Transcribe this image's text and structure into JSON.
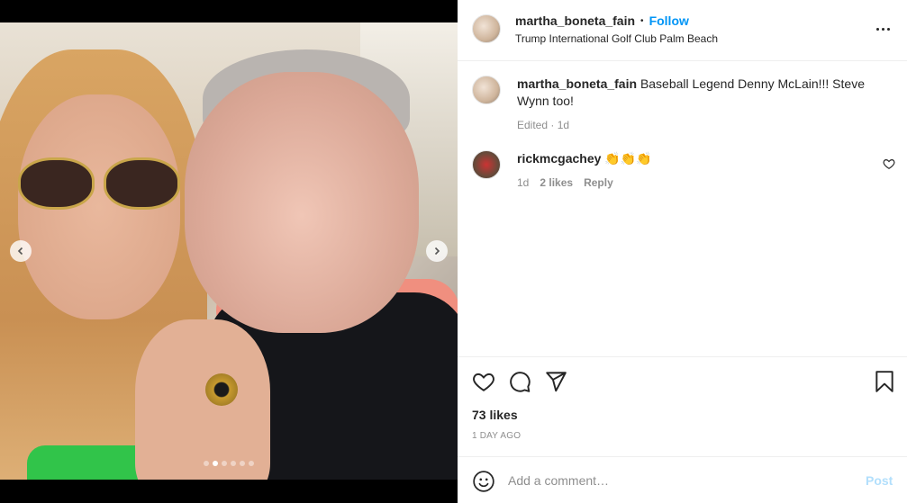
{
  "header": {
    "username": "martha_boneta_fain",
    "separator": "•",
    "follow_label": "Follow",
    "location": "Trump International Golf Club Palm Beach",
    "more_icon": "more-horizontal-icon"
  },
  "media": {
    "carousel_total": 6,
    "carousel_active": 2,
    "prev_icon": "chevron-left-icon",
    "next_icon": "chevron-right-icon"
  },
  "comments": [
    {
      "username": "martha_boneta_fain",
      "text": "Baseball Legend Denny McLain!!! Steve Wynn too!",
      "meta_edited": "Edited · 1d"
    },
    {
      "username": "rickmcgachey",
      "text": "👏👏👏",
      "time": "1d",
      "likes": "2 likes",
      "reply_label": "Reply"
    }
  ],
  "actions": {
    "likes": "73 likes",
    "timestamp": "1 DAY AGO"
  },
  "add_comment": {
    "placeholder": "Add a comment…",
    "post_label": "Post"
  },
  "colors": {
    "accent": "#0095f6",
    "post_disabled": "#b2dffc",
    "muted": "#8e8e8e",
    "text": "#262626"
  }
}
